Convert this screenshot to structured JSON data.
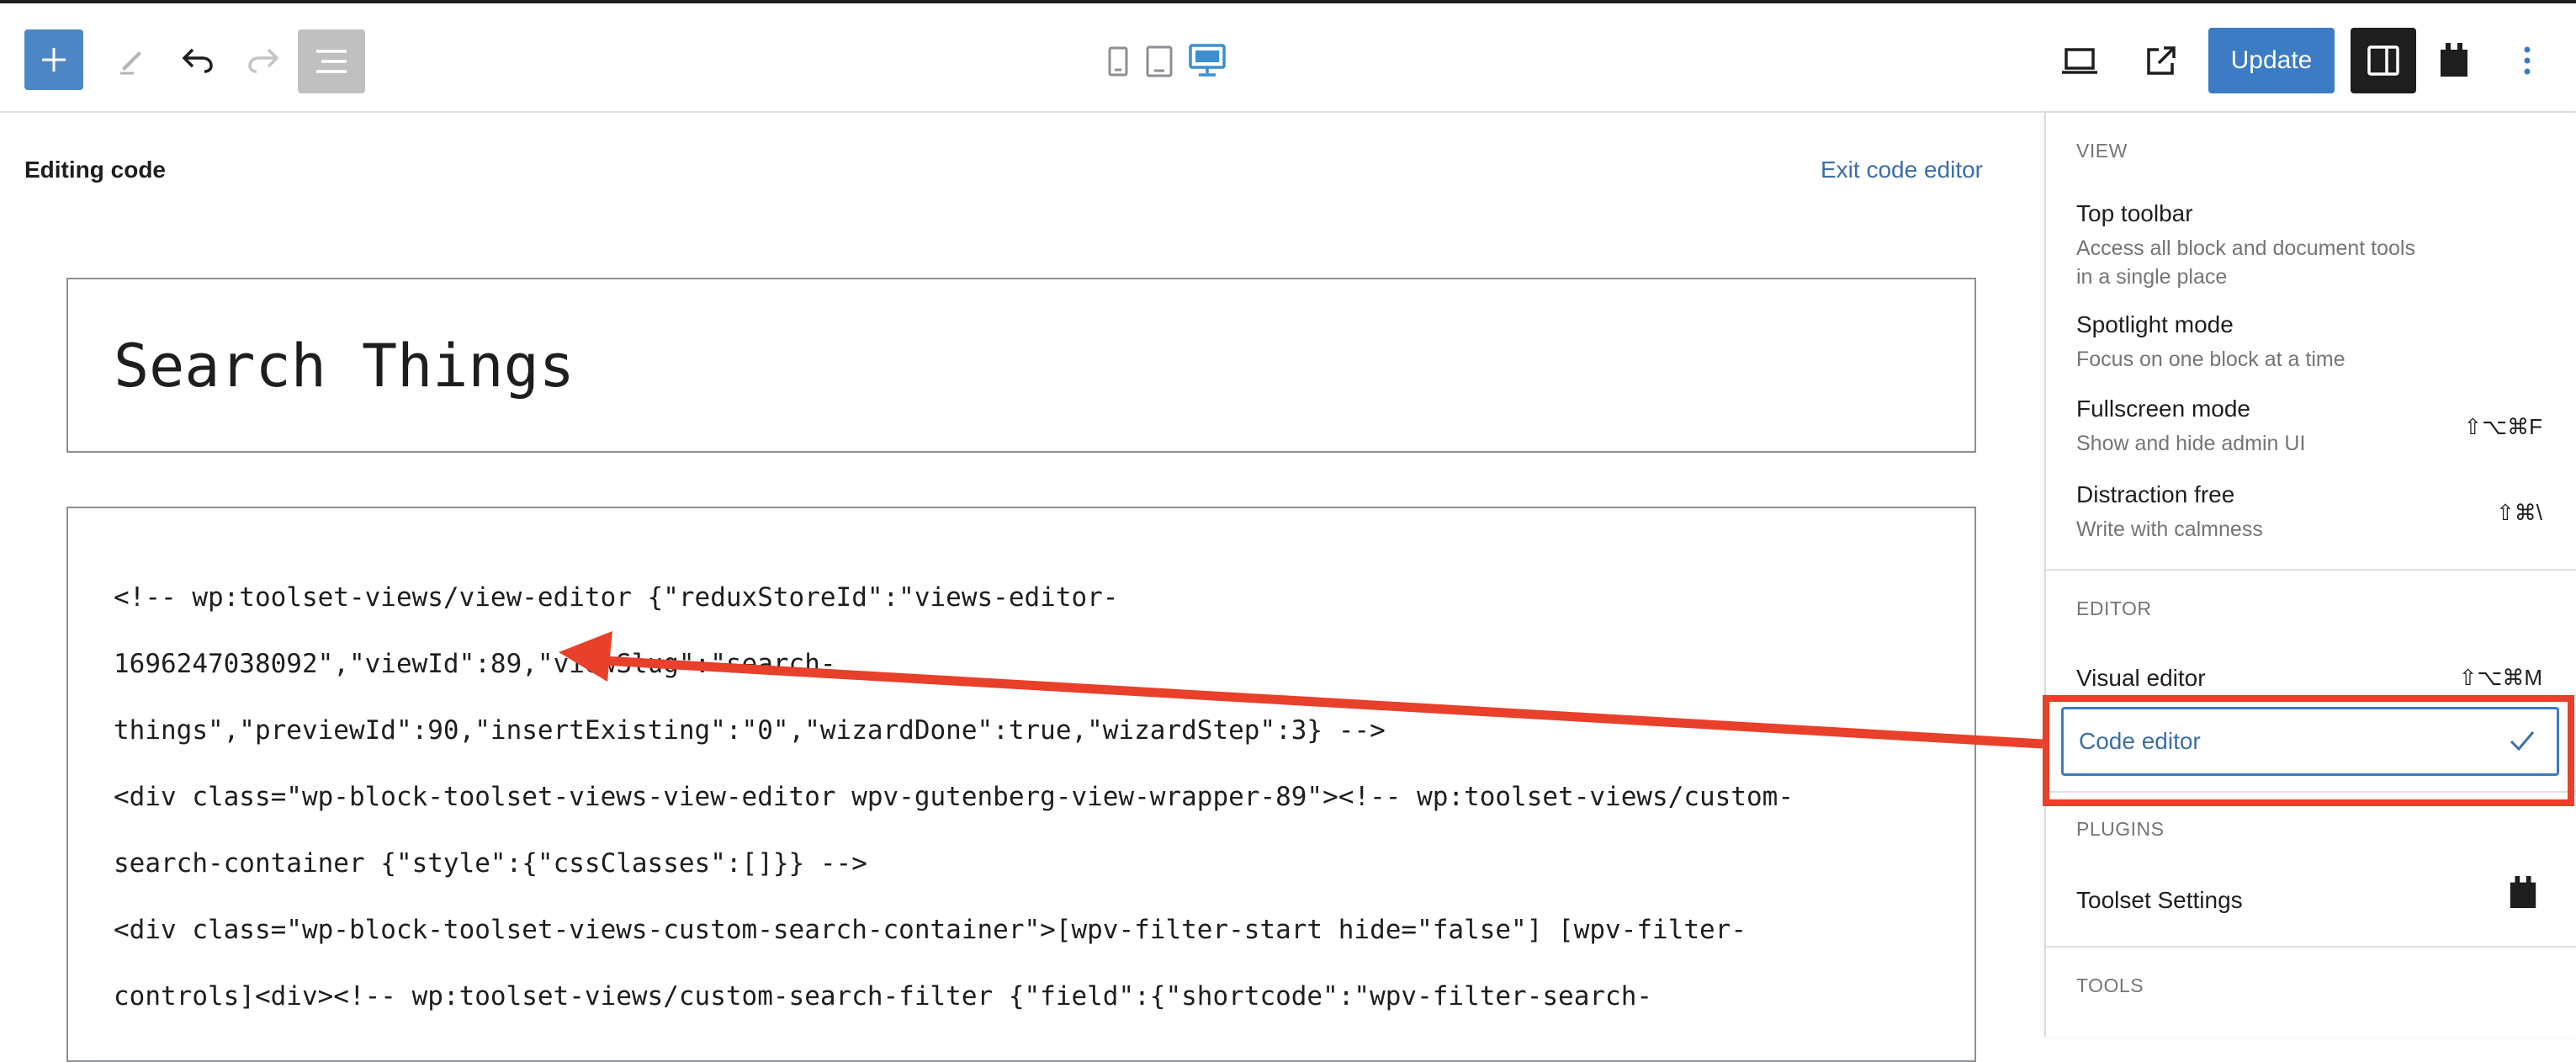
{
  "toolbar": {
    "inserter_icon": "plus-icon",
    "tools_icon": "pencil-icon",
    "undo_icon": "undo-icon",
    "redo_icon": "redo-icon",
    "outline_icon": "list-view-icon",
    "devices": [
      "mobile-icon",
      "tablet-icon",
      "desktop-icon"
    ],
    "active_device": "desktop",
    "update_label": "Update",
    "accent_color": "#3b7cc4"
  },
  "editor": {
    "status_label": "Editing code",
    "exit_label": "Exit code editor",
    "title": "Search Things",
    "code_lines": [
      "<!-- wp:toolset-views/view-editor {\"reduxStoreId\":\"views-editor-",
      "1696247038092\",\"viewId\":89,\"viewSlug\":\"search-",
      "things\",\"previewId\":90,\"insertExisting\":\"0\",\"wizardDone\":true,\"wizardStep\":3} -->",
      "<div class=\"wp-block-toolset-views-view-editor wpv-gutenberg-view-wrapper-89\"><!-- wp:toolset-views/custom-",
      "search-container {\"style\":{\"cssClasses\":[]}} -->",
      "<div class=\"wp-block-toolset-views-custom-search-container\">[wpv-filter-start hide=\"false\"] [wpv-filter-",
      "controls]<div><!-- wp:toolset-views/custom-search-filter {\"field\":{\"shortcode\":\"wpv-filter-search-"
    ]
  },
  "menu": {
    "view_title": "VIEW",
    "view_items": [
      {
        "label": "Top toolbar",
        "desc": "Access all block and document tools in a single place",
        "shortcut": ""
      },
      {
        "label": "Spotlight mode",
        "desc": "Focus on one block at a time",
        "shortcut": ""
      },
      {
        "label": "Fullscreen mode",
        "desc": "Show and hide admin UI",
        "shortcut": "⇧⌥⌘F"
      },
      {
        "label": "Distraction free",
        "desc": "Write with calmness",
        "shortcut": "⇧⌘\\"
      }
    ],
    "editor_title": "EDITOR",
    "visual_editor": {
      "label": "Visual editor",
      "shortcut": "⇧⌥⌘M"
    },
    "code_editor": {
      "label": "Code editor",
      "selected": true
    },
    "plugins_title": "PLUGINS",
    "toolset_settings": "Toolset Settings",
    "tools_title": "TOOLS"
  },
  "annotation": {
    "color": "#e8402a",
    "highlight": "code-editor-menu-item",
    "arrow_target": "code-editor-content"
  }
}
